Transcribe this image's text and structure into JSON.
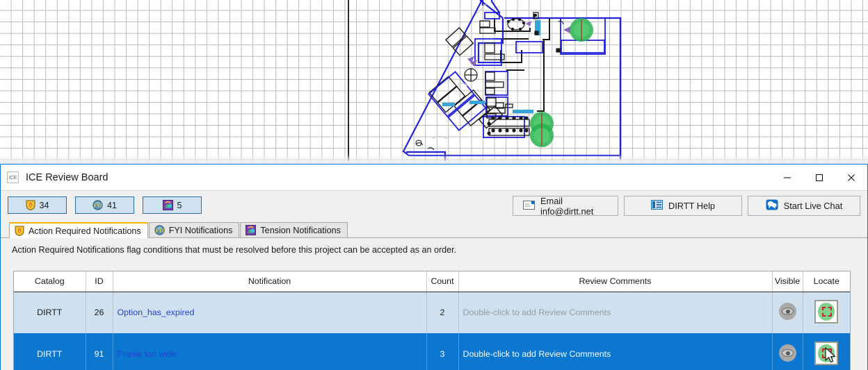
{
  "window": {
    "title": "ICE Review Board",
    "app_icon": "ICE",
    "minimize_label": "Minimize",
    "maximize_label": "Maximize",
    "close_label": "Close"
  },
  "toolbar": {
    "pills": [
      {
        "name": "action-required-count",
        "icon": "shield-flame-icon",
        "count": "34"
      },
      {
        "name": "fyi-count",
        "icon": "fyi-circle-icon",
        "count": "41"
      },
      {
        "name": "tension-count",
        "icon": "tension-icon",
        "count": "5"
      }
    ],
    "buttons": [
      {
        "name": "email-button",
        "label": "Email info@dirtt.net",
        "icon": "envelope-icon"
      },
      {
        "name": "dirtt-help-button",
        "label": "DIRTT Help",
        "icon": "help-grid-icon"
      },
      {
        "name": "start-live-chat-button",
        "label": "Start Live Chat",
        "icon": "chat-bubble-icon"
      }
    ]
  },
  "tabs": [
    {
      "label": "Action Required Notifications",
      "icon": "shield-flame-icon",
      "active": true
    },
    {
      "label": "FYI Notifications",
      "icon": "fyi-circle-icon",
      "active": false
    },
    {
      "label": "Tension Notifications",
      "icon": "tension-icon",
      "active": false
    }
  ],
  "description": "Action Required Notifications flag conditions that must be resolved before this project can be accepted as an order.",
  "table": {
    "columns": [
      "Catalog",
      "ID",
      "Notification",
      "Count",
      "Review Comments",
      "Visible",
      "Locate"
    ],
    "rows": [
      {
        "catalog": "DIRTT",
        "id": "26",
        "notification": "Option_has_expired",
        "count": "2",
        "comments": "Double-click to add Review Comments",
        "comments_is_placeholder": true,
        "visible_icon": "eye-icon",
        "locate_icon": "locate-target-icon",
        "selected": false
      },
      {
        "catalog": "DIRTT",
        "id": "91",
        "notification": "Frame too wide",
        "count": "3",
        "comments": "Double-click to add Review Comments",
        "comments_is_placeholder": false,
        "visible_icon": "eye-icon",
        "locate_icon": "locate-target-icon",
        "selected": true
      }
    ]
  },
  "colors": {
    "accent_blue": "#0078d7",
    "selected_row": "#0c77cf",
    "row_tint": "#cfe0ef",
    "pill_fill": "#cfe2f1",
    "pill_border": "#2a6ca8",
    "tab_active_top": "#ffb300",
    "link_blue": "#2440d8",
    "locate_green": "#7fd18d",
    "locate_red": "#cc2222",
    "cad_wall_blue": "#2222dd",
    "cad_marker_green": "#22b24c",
    "cad_grid": "#b9b9b9"
  },
  "canvas": {
    "name": "floor-plan-canvas",
    "description": "CAD floor plan drawing with blue walls, furniture blocks and green circular markers"
  }
}
